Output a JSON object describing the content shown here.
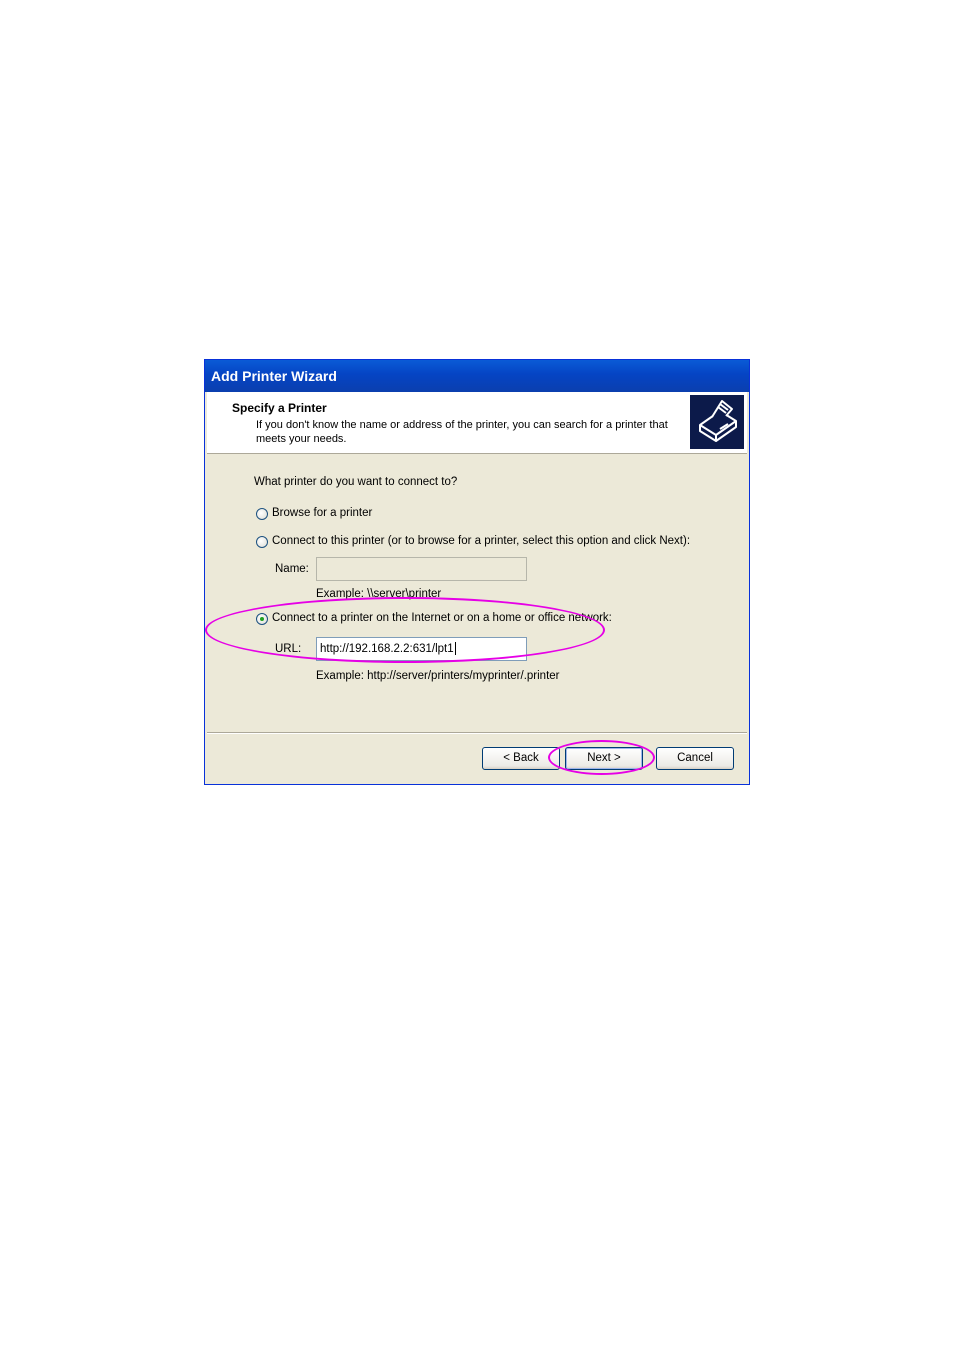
{
  "window": {
    "title": "Add Printer Wizard"
  },
  "header": {
    "title": "Specify a Printer",
    "description": "If you don't know the name or address of the printer, you can search for a printer that meets your needs.",
    "icon": "printer-icon"
  },
  "content": {
    "question": "What printer do you want to connect to?",
    "options": [
      {
        "label": "Browse for a printer",
        "selected": false
      },
      {
        "label": "Connect to this printer (or to browse for a printer, select this option and click Next):",
        "selected": false
      },
      {
        "label": "Connect to a printer on the Internet or on a home or office network:",
        "selected": true
      }
    ],
    "name_field": {
      "label": "Name:",
      "value": "",
      "example": "Example: \\\\server\\printer"
    },
    "url_field": {
      "label": "URL:",
      "value": "http://192.168.2.2:631/lpt1",
      "example": "Example: http://server/printers/myprinter/.printer"
    }
  },
  "buttons": {
    "back": "< Back",
    "next": "Next >",
    "cancel": "Cancel"
  },
  "colors": {
    "highlight": "#e600e6",
    "titlebar": "#0a5bd6",
    "dialog_bg": "#ece9d8"
  }
}
